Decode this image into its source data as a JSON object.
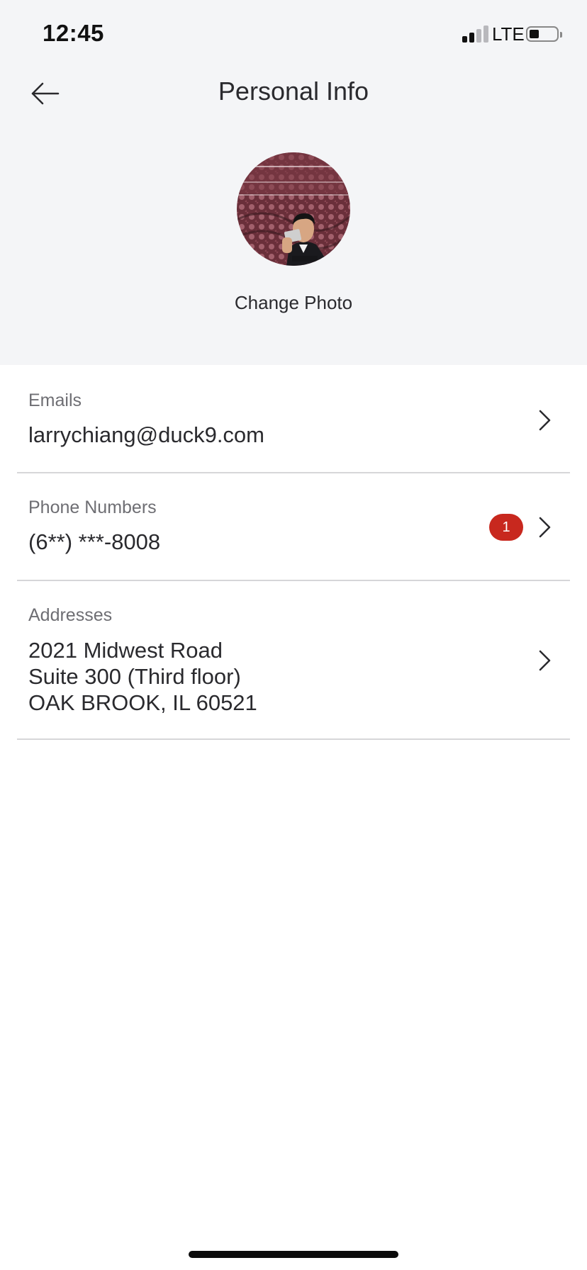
{
  "status_bar": {
    "time": "12:45",
    "network": "LTE",
    "signal_bars": 2,
    "battery_level": 0.3,
    "icons": [
      "signal-icon",
      "battery-icon"
    ]
  },
  "header": {
    "title": "Personal Info",
    "back_icon": "arrow-left-icon"
  },
  "profile": {
    "change_photo_label": "Change Photo"
  },
  "sections": [
    {
      "label": "Emails",
      "lines": [
        "larrychiang@duck9.com"
      ],
      "icon": "chevron-right-icon"
    },
    {
      "label": "Phone Numbers",
      "lines": [
        "(6**) ***-8008"
      ],
      "badge": "1",
      "icon": "chevron-right-icon"
    },
    {
      "label": "Addresses",
      "lines": [
        "2021 Midwest Road",
        "Suite 300 (Third floor)",
        "OAK BROOK, IL 60521"
      ],
      "icon": "chevron-right-icon"
    }
  ],
  "colors": {
    "header_background": "#f4f5f7",
    "badge": "#c8281e",
    "divider": "#d6d6d8",
    "secondary_text": "#6e6e73"
  }
}
